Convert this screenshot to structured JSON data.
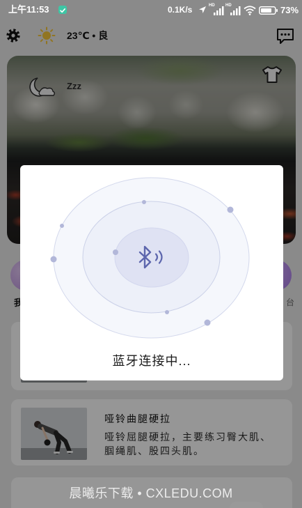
{
  "status_bar": {
    "time": "上午11:53",
    "net_speed": "0.1K/s",
    "signal_1": "HD",
    "signal_2": "HD",
    "battery": "73%",
    "icons": [
      "check-icon",
      "location-icon",
      "signal-icon",
      "signal-icon",
      "wifi-icon",
      "battery-icon"
    ]
  },
  "header": {
    "weather": "23℃ • 良",
    "icons": {
      "left": "gear-icon",
      "weather": "sun-icon",
      "right": "chat-icon"
    }
  },
  "banner": {
    "sleep_label": "Zzz",
    "icons": {
      "left": "moon-icon",
      "right": "tshirt-icon"
    }
  },
  "shortcuts": [
    {
      "label": "我"
    },
    {
      "label": "台"
    }
  ],
  "exercises": [
    {
      "title": "哑铃曲腿硬拉",
      "description": "哑铃屈腿硬拉，主要练习臀大肌、腘绳肌、股四头肌。"
    }
  ],
  "modal": {
    "icon": "bluetooth-icon",
    "status": "蓝牙连接中..."
  },
  "watermark": "晨曦乐下载 • CXLEDU.COM",
  "theme": {
    "accent": "#5d66ad",
    "status_icon": "#3ec6a5",
    "ring_dot": "#b2b7d9"
  }
}
